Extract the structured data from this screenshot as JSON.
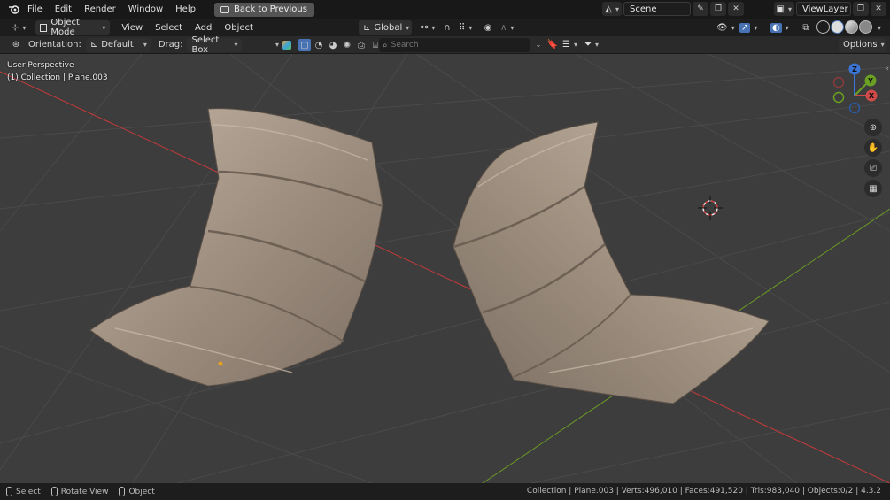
{
  "topbar": {
    "menus": [
      "File",
      "Edit",
      "Render",
      "Window",
      "Help"
    ],
    "back_button": "Back to Previous",
    "scene_name": "Scene",
    "view_layer": "ViewLayer"
  },
  "header1": {
    "mode": "Object Mode",
    "menus": [
      "View",
      "Select",
      "Add",
      "Object"
    ],
    "transform_orientation": "Global"
  },
  "header2": {
    "orientation_label": "Orientation:",
    "orientation_value": "Default",
    "drag_label": "Drag:",
    "drag_value": "Select Box",
    "search_placeholder": "Search",
    "options_label": "Options"
  },
  "viewport": {
    "perspective": "User Perspective",
    "context": "(1) Collection | Plane.003",
    "gizmo_axes": [
      "Z",
      "Y",
      "X"
    ],
    "colors": {
      "background": "#3d3d3d",
      "x_axis": "#c83a3a",
      "y_axis": "#6a9a23",
      "cushion": "#a89a89"
    }
  },
  "statusbar": {
    "select": "Select",
    "rotate": "Rotate View",
    "object": "Object",
    "collection": "Collection",
    "object_name": "Plane.003",
    "verts": "Verts:496,010",
    "faces": "Faces:491,520",
    "tris": "Tris:983,040",
    "objects": "Objects:0/2",
    "version": "4.3.2"
  }
}
